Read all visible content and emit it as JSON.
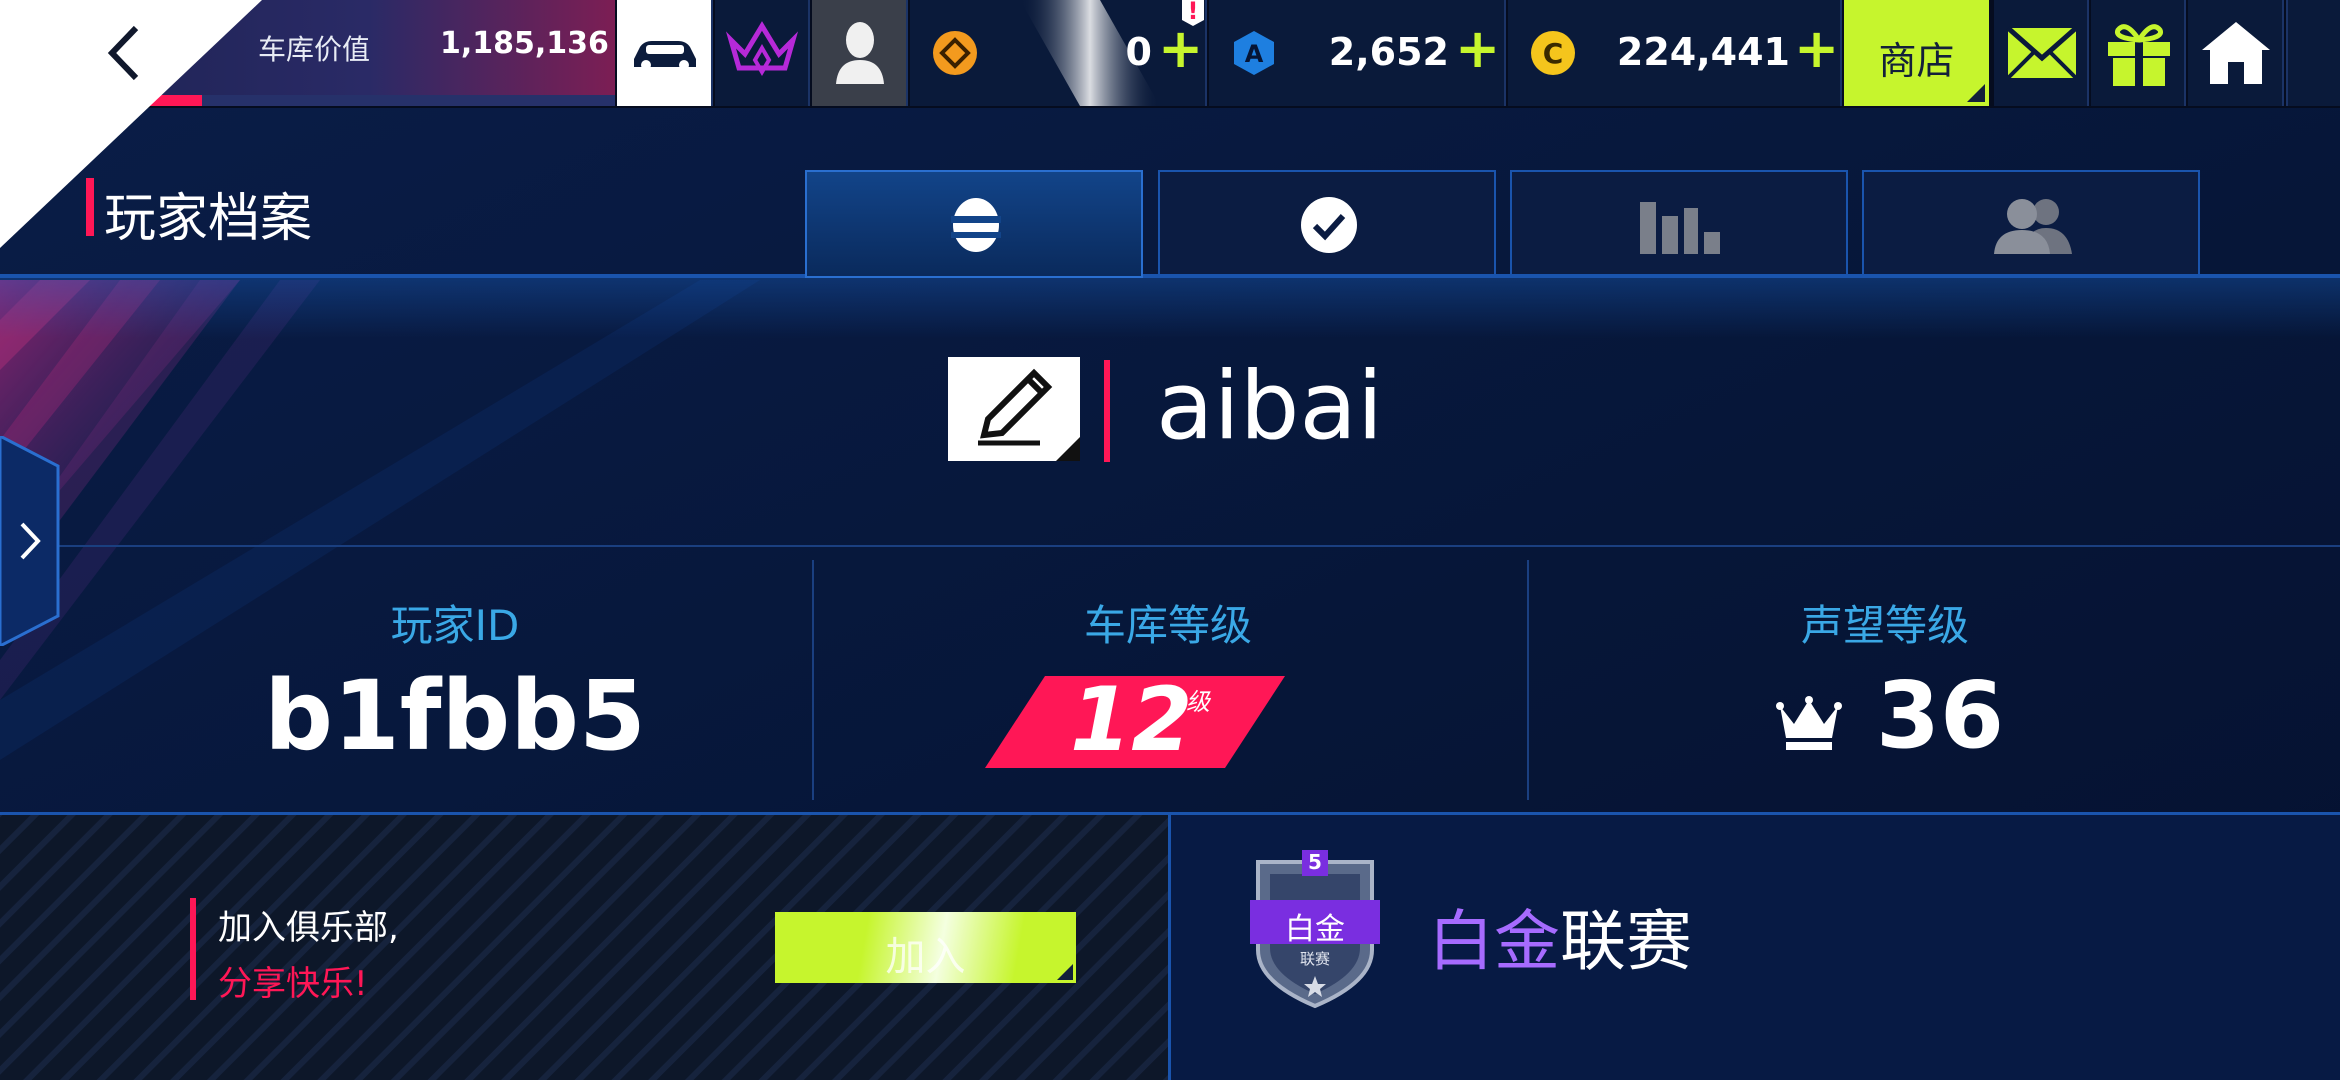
{
  "topbar": {
    "garage_value_label": "车库价值",
    "garage_value": "1,185,136",
    "tokens": "0",
    "alert_badge": "!",
    "blue_credits": "2,652",
    "credits": "224,441",
    "shop_label": "商店",
    "plus_glyph": "+"
  },
  "header": {
    "title": "玩家档案"
  },
  "profile": {
    "username": "aibai",
    "player_id_label": "玩家ID",
    "player_id": "b1fbb5",
    "garage_level_label": "车库等级",
    "garage_level": "12",
    "garage_level_unit": "级",
    "prestige_label": "声望等级",
    "prestige_level": "36"
  },
  "club": {
    "line1": "加入俱乐部,",
    "line2": "分享快乐!",
    "join_label": "加入"
  },
  "league": {
    "badge_number": "5",
    "badge_title": "白金",
    "badge_sub": "联赛",
    "name_highlight": "白金",
    "name_rest": "联赛"
  },
  "colors": {
    "accent_lime": "#c6f52d",
    "accent_pink": "#ff1756",
    "accent_blue": "#3aa8e6",
    "league_purple": "#a66bff",
    "background": "#061434"
  },
  "icons": {
    "back": "chevron-left-icon",
    "car": "car-icon",
    "crown_emblem": "crown-emblem-icon",
    "avatar": "avatar-icon",
    "token": "token-icon",
    "blue_credit": "blue-credit-icon",
    "credit": "credit-icon",
    "mail": "mail-icon",
    "gift": "gift-icon",
    "home": "home-icon",
    "edit": "pencil-icon",
    "profile_tab": "helmet-icon",
    "achievements_tab": "checkmark-icon",
    "stats_tab": "bar-chart-icon",
    "friends_tab": "friends-icon",
    "side_expand": "chevron-right-icon",
    "prestige": "crown-icon"
  }
}
